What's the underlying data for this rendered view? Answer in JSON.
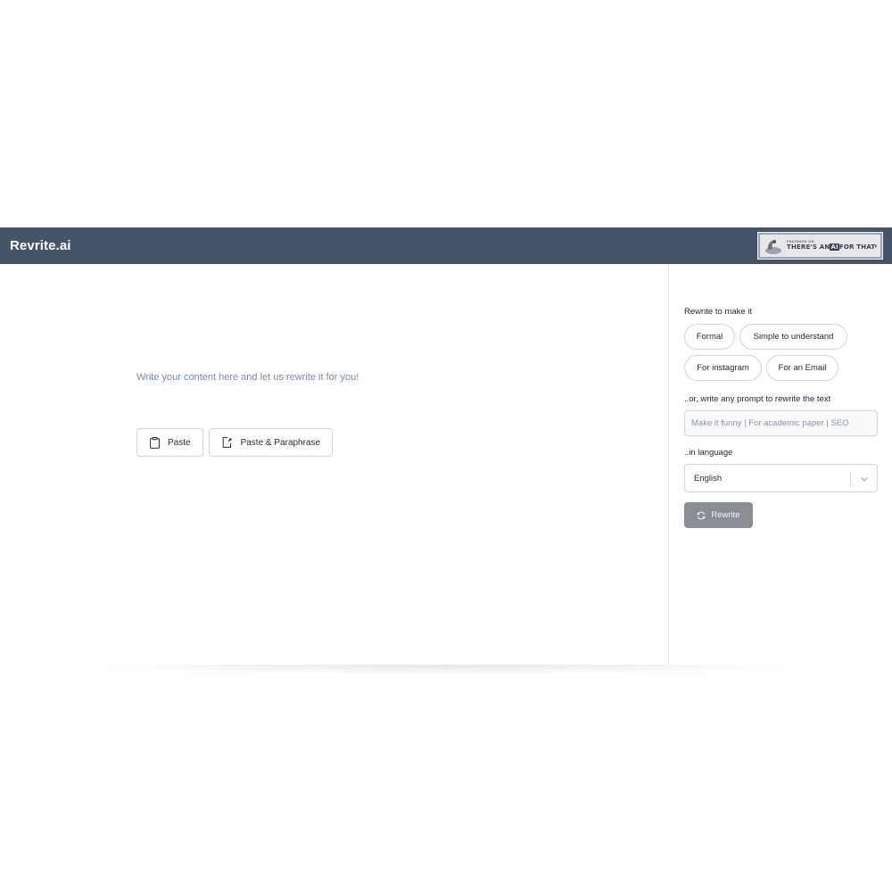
{
  "header": {
    "brand": "Revrite.ai",
    "badge": {
      "small": "FEATURED ON",
      "main_before": "THERE'S AN",
      "main_ai": "AI",
      "main_after": "FOR THAT"
    }
  },
  "editor": {
    "placeholder": "Write your content here and let us rewrite it for you!",
    "paste_label": "Paste",
    "paste_paraphrase_label": "Paste & Paraphrase"
  },
  "panel": {
    "rewrite_heading": "Rewrite to make it",
    "chips": [
      "Formal",
      "Simple to understand",
      "For instagram",
      "For an Email"
    ],
    "prompt_heading": "..or, write any prompt to rewrite the text",
    "prompt_placeholder": "Make it funny | For academic paper | SEO",
    "language_heading": "..in language",
    "language_value": "English",
    "rewrite_button": "Rewrite"
  },
  "colors": {
    "topbar": "#475569",
    "rewrite_button": "#8a8f96",
    "placeholder_text": "#7a8ba3"
  }
}
